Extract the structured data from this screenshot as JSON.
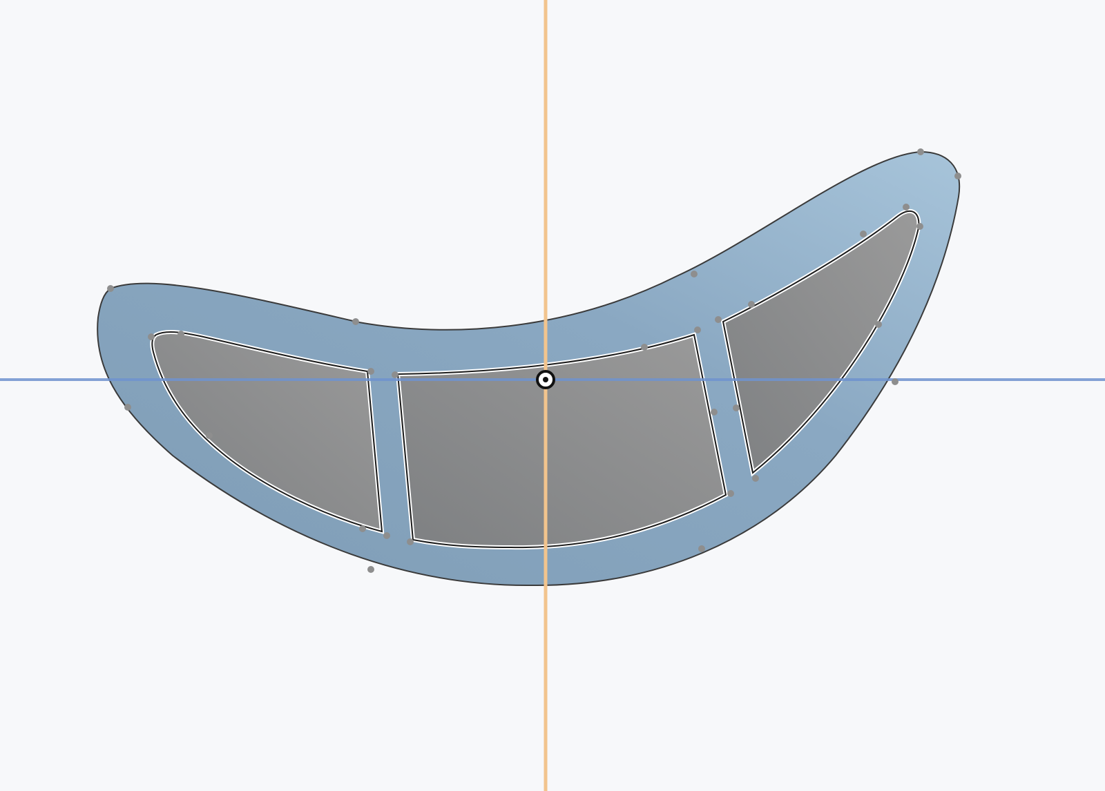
{
  "app": {
    "view": "sketch-canvas"
  },
  "colors": {
    "background": "#f7f8fa",
    "profile_fill": "#8aa8c2",
    "profile_fill_light": "#a2c0d6",
    "pocket_fill": "#858789",
    "outline": "#3a3a3a",
    "vertex": "#8e8e8e",
    "vertical_axis": "#f2c48d",
    "horizontal_axis": "#7d9fd6",
    "origin": "#111111"
  },
  "icons": {
    "origin": "origin-icon",
    "vertex": "sketch-point-icon"
  }
}
